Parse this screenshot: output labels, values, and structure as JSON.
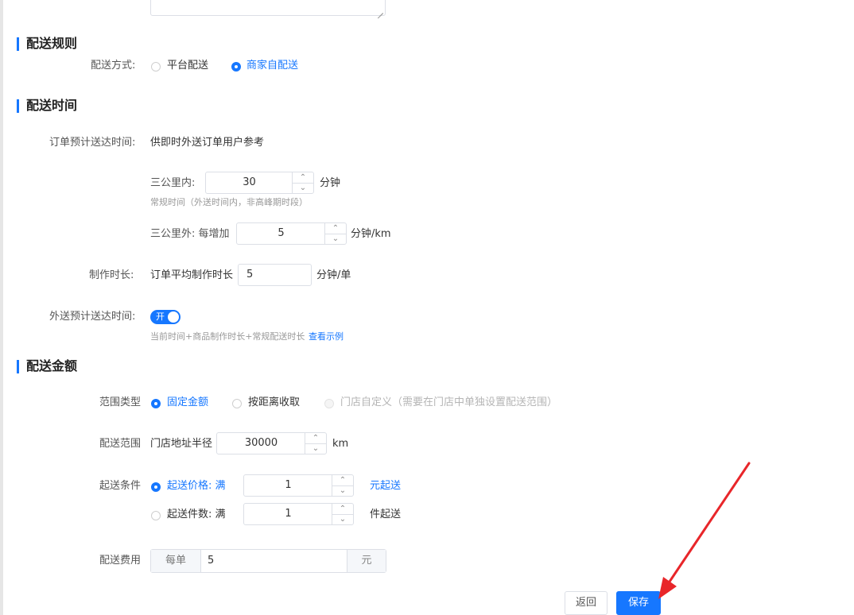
{
  "sections": {
    "rules": "配送规则",
    "time": "配送时间",
    "amount": "配送金额"
  },
  "delivery_rules": {
    "method_label": "配送方式:",
    "options": [
      "平台配送",
      "商家自配送"
    ],
    "selected": "商家自配送"
  },
  "delivery_time": {
    "eta_label": "订单预计送达时间:",
    "eta_desc": "供即时外送订单用户参考",
    "within3_label": "三公里内:",
    "within3_value": "30",
    "within3_unit": "分钟",
    "within3_hint": "常规时间（外送时间内，非高峰期时段）",
    "beyond3_label": "三公里外: 每增加",
    "beyond3_value": "5",
    "beyond3_unit": "分钟/km",
    "prep_label": "制作时长:",
    "prep_desc": "订单平均制作时长",
    "prep_value": "5",
    "prep_unit": "分钟/单",
    "out_eta_label": "外送预计送达时间:",
    "toggle_label": "开",
    "toggle_on": true,
    "formula_hint": "当前时间+商品制作时长+常规配送时长",
    "example_link": "查看示例"
  },
  "delivery_amount": {
    "range_type_label": "范围类型",
    "range_options": [
      "固定金额",
      "按距离收取",
      "门店自定义（需要在门店中单独设置配送范围）"
    ],
    "range_selected": "固定金额",
    "range_label": "配送范围",
    "radius_label": "门店地址半径",
    "radius_value": "30000",
    "radius_unit": "km",
    "min_label": "起送条件",
    "min_price_label": "起送价格: 满",
    "min_price_value": "1",
    "min_price_unit": "元起送",
    "min_qty_label": "起送件数: 满",
    "min_qty_value": "1",
    "min_qty_unit": "件起送",
    "fee_label": "配送费用",
    "fee_prefix": "每单",
    "fee_value": "5",
    "fee_suffix": "元"
  },
  "buttons": {
    "back": "返回",
    "save": "保存"
  },
  "colors": {
    "accent": "#1677ff",
    "annotation_arrow": "#e8262a"
  }
}
